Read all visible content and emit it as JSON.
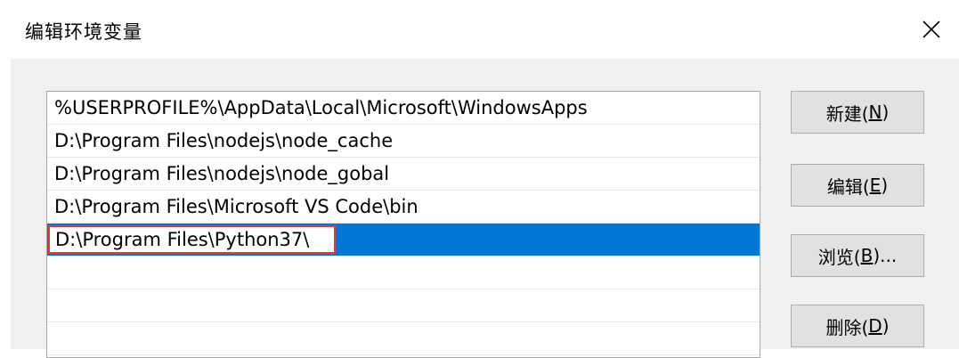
{
  "window": {
    "title": "编辑环境变量"
  },
  "paths": [
    "%USERPROFILE%\\AppData\\Local\\Microsoft\\WindowsApps",
    "D:\\Program Files\\nodejs\\node_cache",
    "D:\\Program Files\\nodejs\\node_gobal",
    "D:\\Program Files\\Microsoft VS Code\\bin"
  ],
  "editing": {
    "value": "D:\\Program Files\\Python37\\"
  },
  "buttons": {
    "new": {
      "text": "新建(",
      "key": "N",
      "end": ")"
    },
    "edit": {
      "text": "编辑(",
      "key": "E",
      "end": ")"
    },
    "browse": {
      "text": "浏览(",
      "key": "B",
      "end": ")..."
    },
    "delete": {
      "text": "删除(",
      "key": "D",
      "end": ")"
    }
  },
  "colors": {
    "selection": "#0078d7",
    "highlight_border": "#e03a3a"
  }
}
